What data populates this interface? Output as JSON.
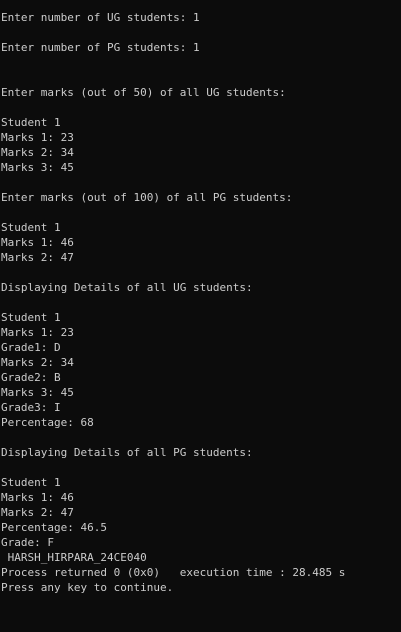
{
  "console": {
    "lines": [
      "Enter number of UG students: 1",
      "",
      "Enter number of PG students: 1",
      "",
      "",
      "Enter marks (out of 50) of all UG students:",
      "",
      "Student 1",
      "Marks 1: 23",
      "Marks 2: 34",
      "Marks 3: 45",
      "",
      "Enter marks (out of 100) of all PG students:",
      "",
      "Student 1",
      "Marks 1: 46",
      "Marks 2: 47",
      "",
      "Displaying Details of all UG students:",
      "",
      "Student 1",
      "Marks 1: 23",
      "Grade1: D",
      "Marks 2: 34",
      "Grade2: B",
      "Marks 3: 45",
      "Grade3: I",
      "Percentage: 68",
      "",
      "Displaying Details of all PG students:",
      "",
      "Student 1",
      "Marks 1: 46",
      "Marks 2: 47",
      "Percentage: 46.5",
      "Grade: F",
      " HARSH_HIRPARA_24CE040",
      "Process returned 0 (0x0)   execution time : 28.485 s",
      "Press any key to continue."
    ]
  },
  "colors": {
    "background": "#0c0c0c",
    "text": "#cccccc"
  }
}
